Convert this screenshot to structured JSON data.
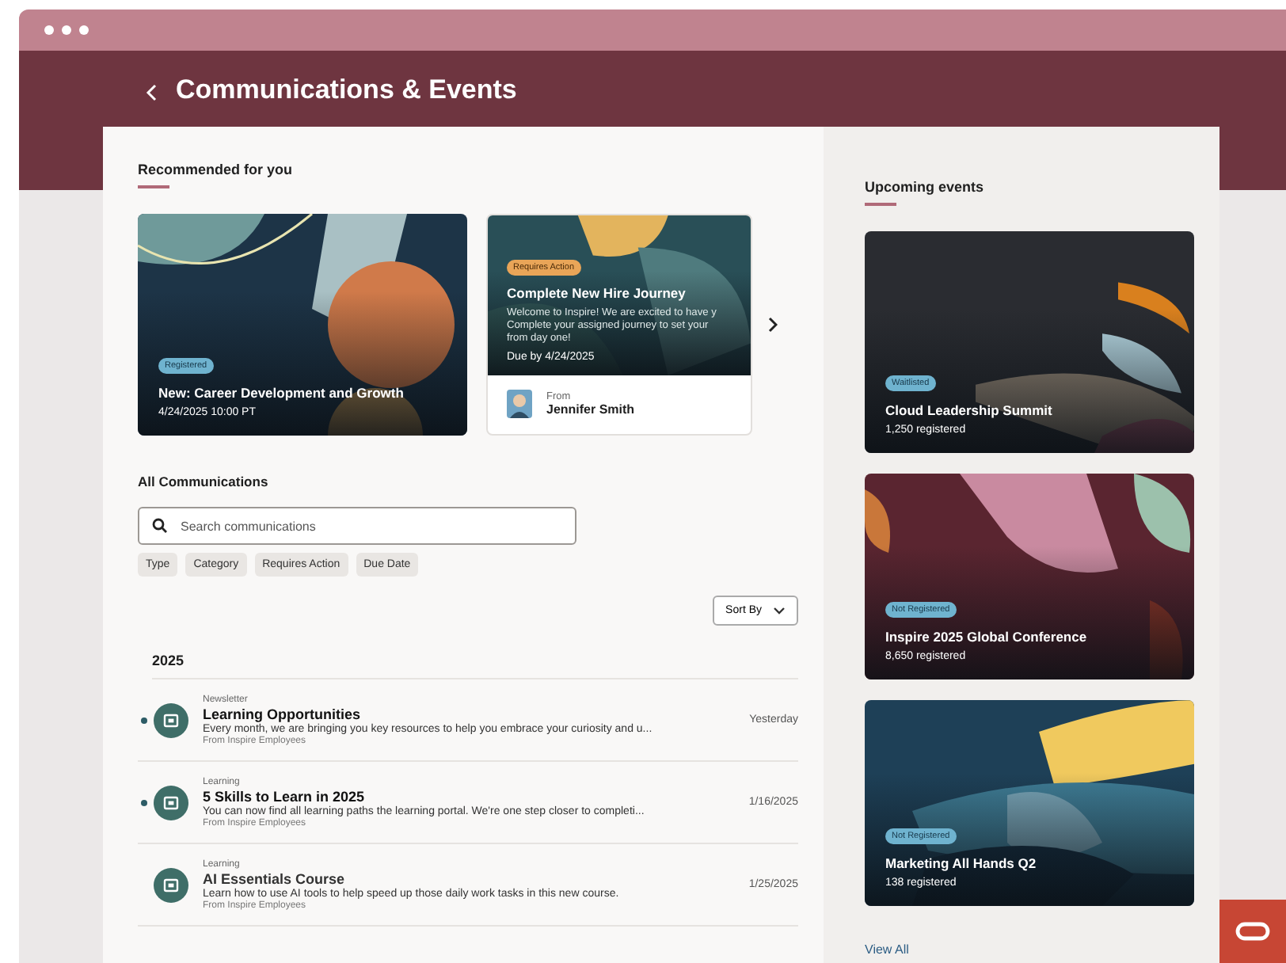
{
  "header": {
    "title": "Communications & Events"
  },
  "recommended": {
    "heading": "Recommended for you",
    "cards": [
      {
        "kind": "event",
        "badge": {
          "label": "Registered",
          "kind": "status"
        },
        "title": "New: Career Development and Growth",
        "meta": "4/24/2025 10:00 PT"
      },
      {
        "kind": "task",
        "badge": {
          "label": "Requires Action",
          "kind": "action"
        },
        "title": "Complete New Hire Journey",
        "body_lines": [
          "Welcome to Inspire! We are excited to have y",
          "Complete your assigned journey to set your",
          "from day one!"
        ],
        "meta": "Due by 4/24/2025",
        "from_label": "From",
        "from_name": "Jennifer Smith"
      }
    ]
  },
  "communications": {
    "heading": "All Communications",
    "search": {
      "placeholder": "Search communications"
    },
    "filters": [
      "Type",
      "Category",
      "Requires Action",
      "Due Date"
    ],
    "sort": "Sort By",
    "group": "2025",
    "items": [
      {
        "category": "Newsletter",
        "title": "Learning Opportunities",
        "summary": "Every month, we are bringing you key resources to help you embrace your curiosity and u...",
        "source": "From Inspire Employees",
        "date": "Yesterday",
        "unread": true
      },
      {
        "category": "Learning",
        "title": "5 Skills to Learn in 2025",
        "summary": "You can now find all learning paths the learning portal. We're one step closer to completi...",
        "source": "From Inspire Employees",
        "date": "1/16/2025",
        "unread": true
      },
      {
        "category": "Learning",
        "title": "AI Essentials Course",
        "summary": "Learn how to use AI tools to help speed up those daily work tasks in this new course.",
        "source": "From Inspire Employees",
        "date": "1/25/2025",
        "unread": false
      }
    ]
  },
  "events": {
    "heading": "Upcoming events",
    "cards": [
      {
        "badge": {
          "label": "Waitlisted",
          "kind": "status"
        },
        "title": "Cloud Leadership Summit",
        "meta": "1,250 registered"
      },
      {
        "badge": {
          "label": "Not Registered",
          "kind": "status"
        },
        "title": "Inspire 2025 Global Conference",
        "meta": "8,650 registered"
      },
      {
        "badge": {
          "label": "Not Registered",
          "kind": "status"
        },
        "title": "Marketing All Hands Q2",
        "meta": "138 registered"
      }
    ],
    "view_all": "View All"
  }
}
